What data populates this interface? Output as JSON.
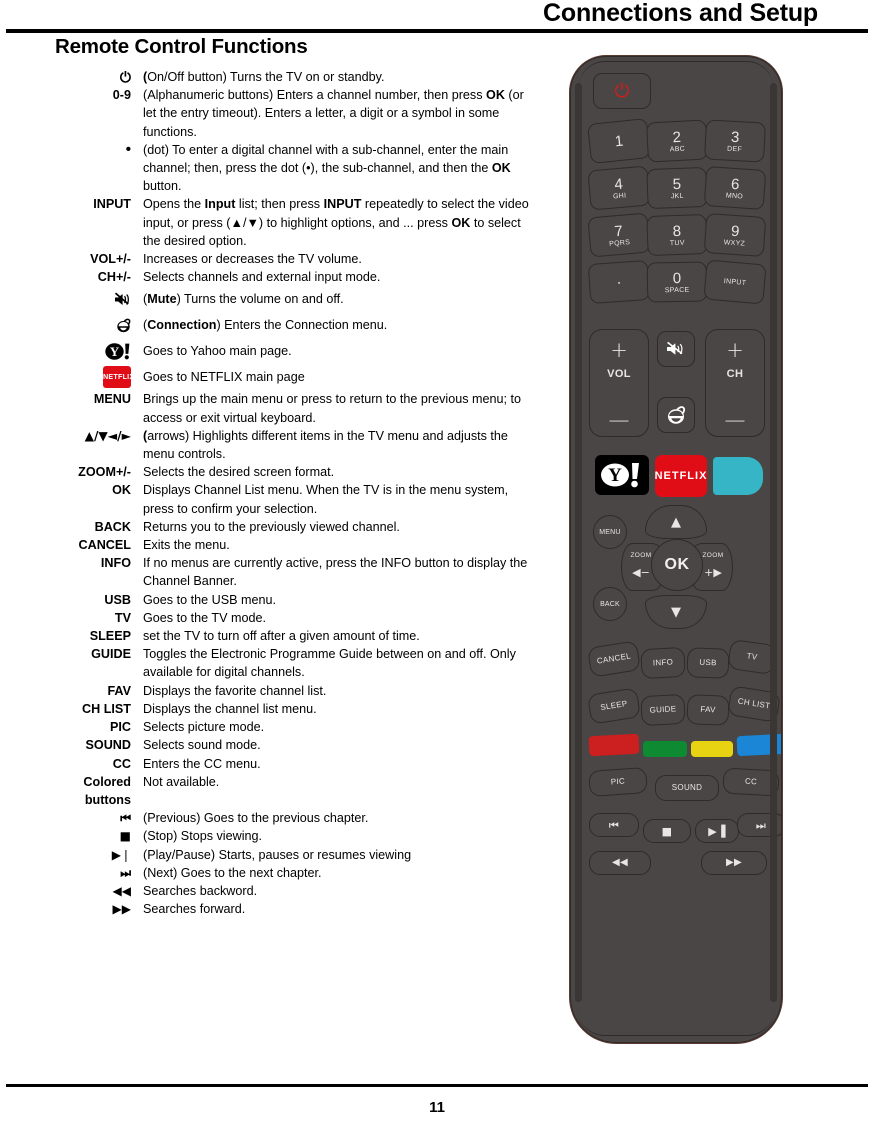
{
  "header": {
    "title": "Connections and Setup",
    "section_heading": "Remote Control Functions"
  },
  "footer": {
    "page_number": "11"
  },
  "functions": [
    {
      "term": "⏻",
      "term_kind": "power-icon",
      "desc_html": "<b>(</b>On/Off button) Turns the TV on or standby."
    },
    {
      "term": "0-9",
      "term_kind": "text",
      "desc_html": "(Alphanumeric buttons) Enters a channel number, then press <b>OK</b> (or let the entry timeout). Enters a  letter, a digit or a symbol in some functions."
    },
    {
      "term": "•",
      "term_kind": "dot",
      "desc_html": "(dot) To enter a digital channel with a sub-channel, enter the main channel; then, press the dot (•), the sub-channel, and then the <b>OK</b> button."
    },
    {
      "term": "INPUT",
      "term_kind": "text",
      "desc_html": "Opens the <b>Input</b> list; then press <b>INPUT</b> repeatedly to select the video input, or press (▲/▼) to highlight options, and  ... press <b>OK</b> to select the desired option."
    },
    {
      "term": "VOL+/-",
      "term_kind": "text",
      "desc_html": "Increases or decreases the TV volume."
    },
    {
      "term": "CH+/-",
      "term_kind": "text",
      "desc_html": "Selects channels and external input mode."
    },
    {
      "term": "",
      "term_kind": "mute-icon",
      "desc_html": "(<b>Mute</b>) Turns the volume on and off."
    },
    {
      "term": "",
      "term_kind": "connection-icon",
      "desc_html": "(<b>Connection</b>) Enters the Connection menu."
    },
    {
      "term": "",
      "term_kind": "yahoo-icon",
      "desc_html": "Goes to Yahoo main page."
    },
    {
      "term": "",
      "term_kind": "netflix-icon",
      "desc_html": "Goes to NETFLIX main page"
    },
    {
      "term": "MENU",
      "term_kind": "text",
      "desc_html": "Brings up the main menu or press to return to the previous menu; to access or exit virtual keyboard."
    },
    {
      "term": "▲/▼◄/►",
      "term_kind": "arrows",
      "desc_html": "<b>(</b>arrows)  Highlights different items in the TV menu and adjusts the menu controls."
    },
    {
      "term": "ZOOM+/-",
      "term_kind": "text",
      "desc_html": "Selects the desired screen format."
    },
    {
      "term": "OK",
      "term_kind": "text",
      "desc_html": "Displays Channel List menu. When the TV is in the menu system, press to confirm your selection."
    },
    {
      "term": "BACK",
      "term_kind": "text",
      "desc_html": "Returns you to the previously viewed channel."
    },
    {
      "term": "CANCEL",
      "term_kind": "text",
      "desc_html": "Exits the menu."
    },
    {
      "term": "INFO",
      "term_kind": "text",
      "desc_html": "If no menus are currently active, press the INFO button to display the Channel Banner."
    },
    {
      "term": "USB",
      "term_kind": "text",
      "desc_html": "Goes to the USB menu."
    },
    {
      "term": "TV",
      "term_kind": "text",
      "desc_html": "Goes to the TV mode."
    },
    {
      "term": "SLEEP",
      "term_kind": "text",
      "desc_html": "set the TV to turn off after a given amount of time."
    },
    {
      "term": "GUIDE",
      "term_kind": "text",
      "desc_html": "Toggles the Electronic Programme Guide between on and off. Only available for digital channels."
    },
    {
      "term": "FAV",
      "term_kind": "text",
      "desc_html": "Displays the favorite channel list."
    },
    {
      "term": "CH LIST",
      "term_kind": "text",
      "desc_html": "Displays the channel list menu."
    },
    {
      "term": "PIC",
      "term_kind": "text",
      "desc_html": "Selects picture mode."
    },
    {
      "term": "SOUND",
      "term_kind": "text",
      "desc_html": "Selects sound mode."
    },
    {
      "term": "CC",
      "term_kind": "text",
      "desc_html": "Enters the CC menu."
    },
    {
      "term": "Colored buttons",
      "term_kind": "text-wrap",
      "desc_html": "Not available."
    },
    {
      "term": "◀▐",
      "term_kind": "media-prev",
      "desc_html": "(Previous) Goes to the previous chapter."
    },
    {
      "term": "■",
      "term_kind": "media-stop",
      "desc_html": "(Stop) Stops viewing."
    },
    {
      "term": "▶▐",
      "term_kind": "media-playpause",
      "desc_html": "(Play/Pause) Starts, pauses or resumes viewing"
    },
    {
      "term": "▌▶",
      "term_kind": "media-next",
      "desc_html": "(Next) Goes to the next chapter."
    },
    {
      "term": "◀◀",
      "term_kind": "media-rew",
      "desc_html": "Searches backword."
    },
    {
      "term": "▶▶",
      "term_kind": "media-ff",
      "desc_html": "Searches forward."
    }
  ],
  "remote": {
    "power_label": "⏻",
    "keypad": [
      {
        "num": "1",
        "sub": ""
      },
      {
        "num": "2",
        "sub": "ABC"
      },
      {
        "num": "3",
        "sub": "DEF"
      },
      {
        "num": "4",
        "sub": "GHI"
      },
      {
        "num": "5",
        "sub": "JKL"
      },
      {
        "num": "6",
        "sub": "MNO"
      },
      {
        "num": "7",
        "sub": "PQRS"
      },
      {
        "num": "8",
        "sub": "TUV"
      },
      {
        "num": "9",
        "sub": "WXYZ"
      },
      {
        "num": "·",
        "sub": ""
      },
      {
        "num": "0",
        "sub": "SPACE"
      },
      {
        "num": "",
        "sub": "INPUT"
      }
    ],
    "vol_label": "VOL",
    "ch_label": "CH",
    "plus": "+",
    "minus": "—",
    "netflix_label": "NETFLIX",
    "menu_label": "MENU",
    "back_label": "BACK",
    "ok_label": "OK",
    "zoom_label": "ZOOM",
    "zoom_minus": "◀−",
    "zoom_plus": "+▶",
    "up_glyph": "▲",
    "down_glyph": "▼",
    "row_cancel": [
      "CANCEL",
      "INFO",
      "USB",
      "TV"
    ],
    "row_sleep": [
      "SLEEP",
      "GUIDE",
      "FAV",
      "CH LIST"
    ],
    "row_pic": [
      "PIC",
      "SOUND",
      "CC"
    ],
    "media_row1": [
      "⏮",
      "■",
      "▶▐",
      "⏭"
    ],
    "media_row2": [
      "◀◀",
      "▶▶"
    ],
    "colors": {
      "red": "#cc1f1f",
      "green": "#0e8a33",
      "yellow": "#e8d313",
      "blue": "#1b85d6",
      "netflix_red": "#e00d17",
      "teal": "#35b5c6",
      "body": "#4a4645",
      "power_red": "#d21b1b"
    }
  }
}
